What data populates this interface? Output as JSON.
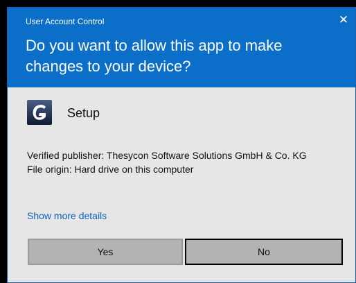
{
  "dialog": {
    "window_title": "User Account Control",
    "close_glyph": "✕",
    "question": "Do you want to allow this app to make changes to your device?"
  },
  "app": {
    "name": "Setup",
    "icon": "setup-app-icon"
  },
  "details": {
    "publisher_line": "Verified publisher: Thesycon Software Solutions GmbH & Co. KG",
    "origin_line": "File origin: Hard drive on this computer"
  },
  "show_more_label": "Show more details",
  "buttons": {
    "yes": "Yes",
    "no": "No"
  },
  "colors": {
    "header": "#0b6ec9",
    "body": "#e6e6e6",
    "link": "#0a63b5",
    "button": "#b3b3b3"
  }
}
